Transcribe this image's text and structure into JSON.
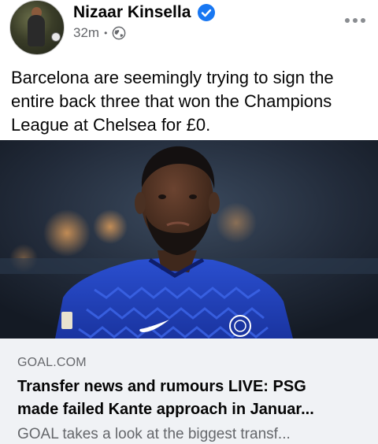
{
  "post": {
    "author_name": "Nizaar Kinsella",
    "verified_icon": "verified-badge-icon",
    "timestamp": "32m",
    "separator": "•",
    "audience_icon": "globe-icon",
    "more_icon": "more-options-icon",
    "text": "Barcelona are seemingly trying to sign the entire back three that won the Champions League at Chelsea for £0."
  },
  "link": {
    "domain": "GOAL.COM",
    "headline_line1": "Transfer news and rumours LIVE: PSG",
    "headline_line2": "made failed Kante approach in Januar...",
    "description": "GOAL takes a look at the biggest transf..."
  },
  "colors": {
    "verified_blue": "#1877f2",
    "meta_gray": "#65676b",
    "preview_bg": "#f0f2f5",
    "kit_blue": "#1d3fae"
  }
}
